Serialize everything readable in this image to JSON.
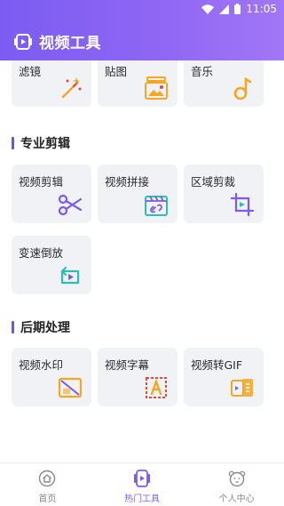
{
  "status": {
    "time": "11:05"
  },
  "header": {
    "title": "视频工具"
  },
  "sections": {
    "top_row": [
      {
        "label": "滤镜",
        "icon": "magic-wand-icon"
      },
      {
        "label": "贴图",
        "icon": "image-stack-icon"
      },
      {
        "label": "音乐",
        "icon": "music-note-icon"
      }
    ],
    "pro_edit": {
      "title": "专业剪辑",
      "items": [
        {
          "label": "视频剪辑",
          "icon": "scissors-icon"
        },
        {
          "label": "视频拼接",
          "icon": "clapper-link-icon"
        },
        {
          "label": "区域剪裁",
          "icon": "crop-icon"
        },
        {
          "label": "变速倒放",
          "icon": "reverse-play-icon"
        }
      ]
    },
    "post": {
      "title": "后期处理",
      "items": [
        {
          "label": "视频水印",
          "icon": "watermark-icon"
        },
        {
          "label": "视频字幕",
          "icon": "subtitle-icon"
        },
        {
          "label": "视频转GIF",
          "icon": "gif-convert-icon"
        }
      ]
    }
  },
  "bottom_nav": [
    {
      "label": "首页",
      "icon": "home-icon"
    },
    {
      "label": "热门工具",
      "icon": "hot-tools-icon",
      "active": true
    },
    {
      "label": "个人中心",
      "icon": "bear-profile-icon"
    }
  ],
  "colors": {
    "accent": "#7b5cf2",
    "orange": "#f5a623",
    "purple_icon": "#7a5af0",
    "teal_icon": "#2bbfb3"
  }
}
